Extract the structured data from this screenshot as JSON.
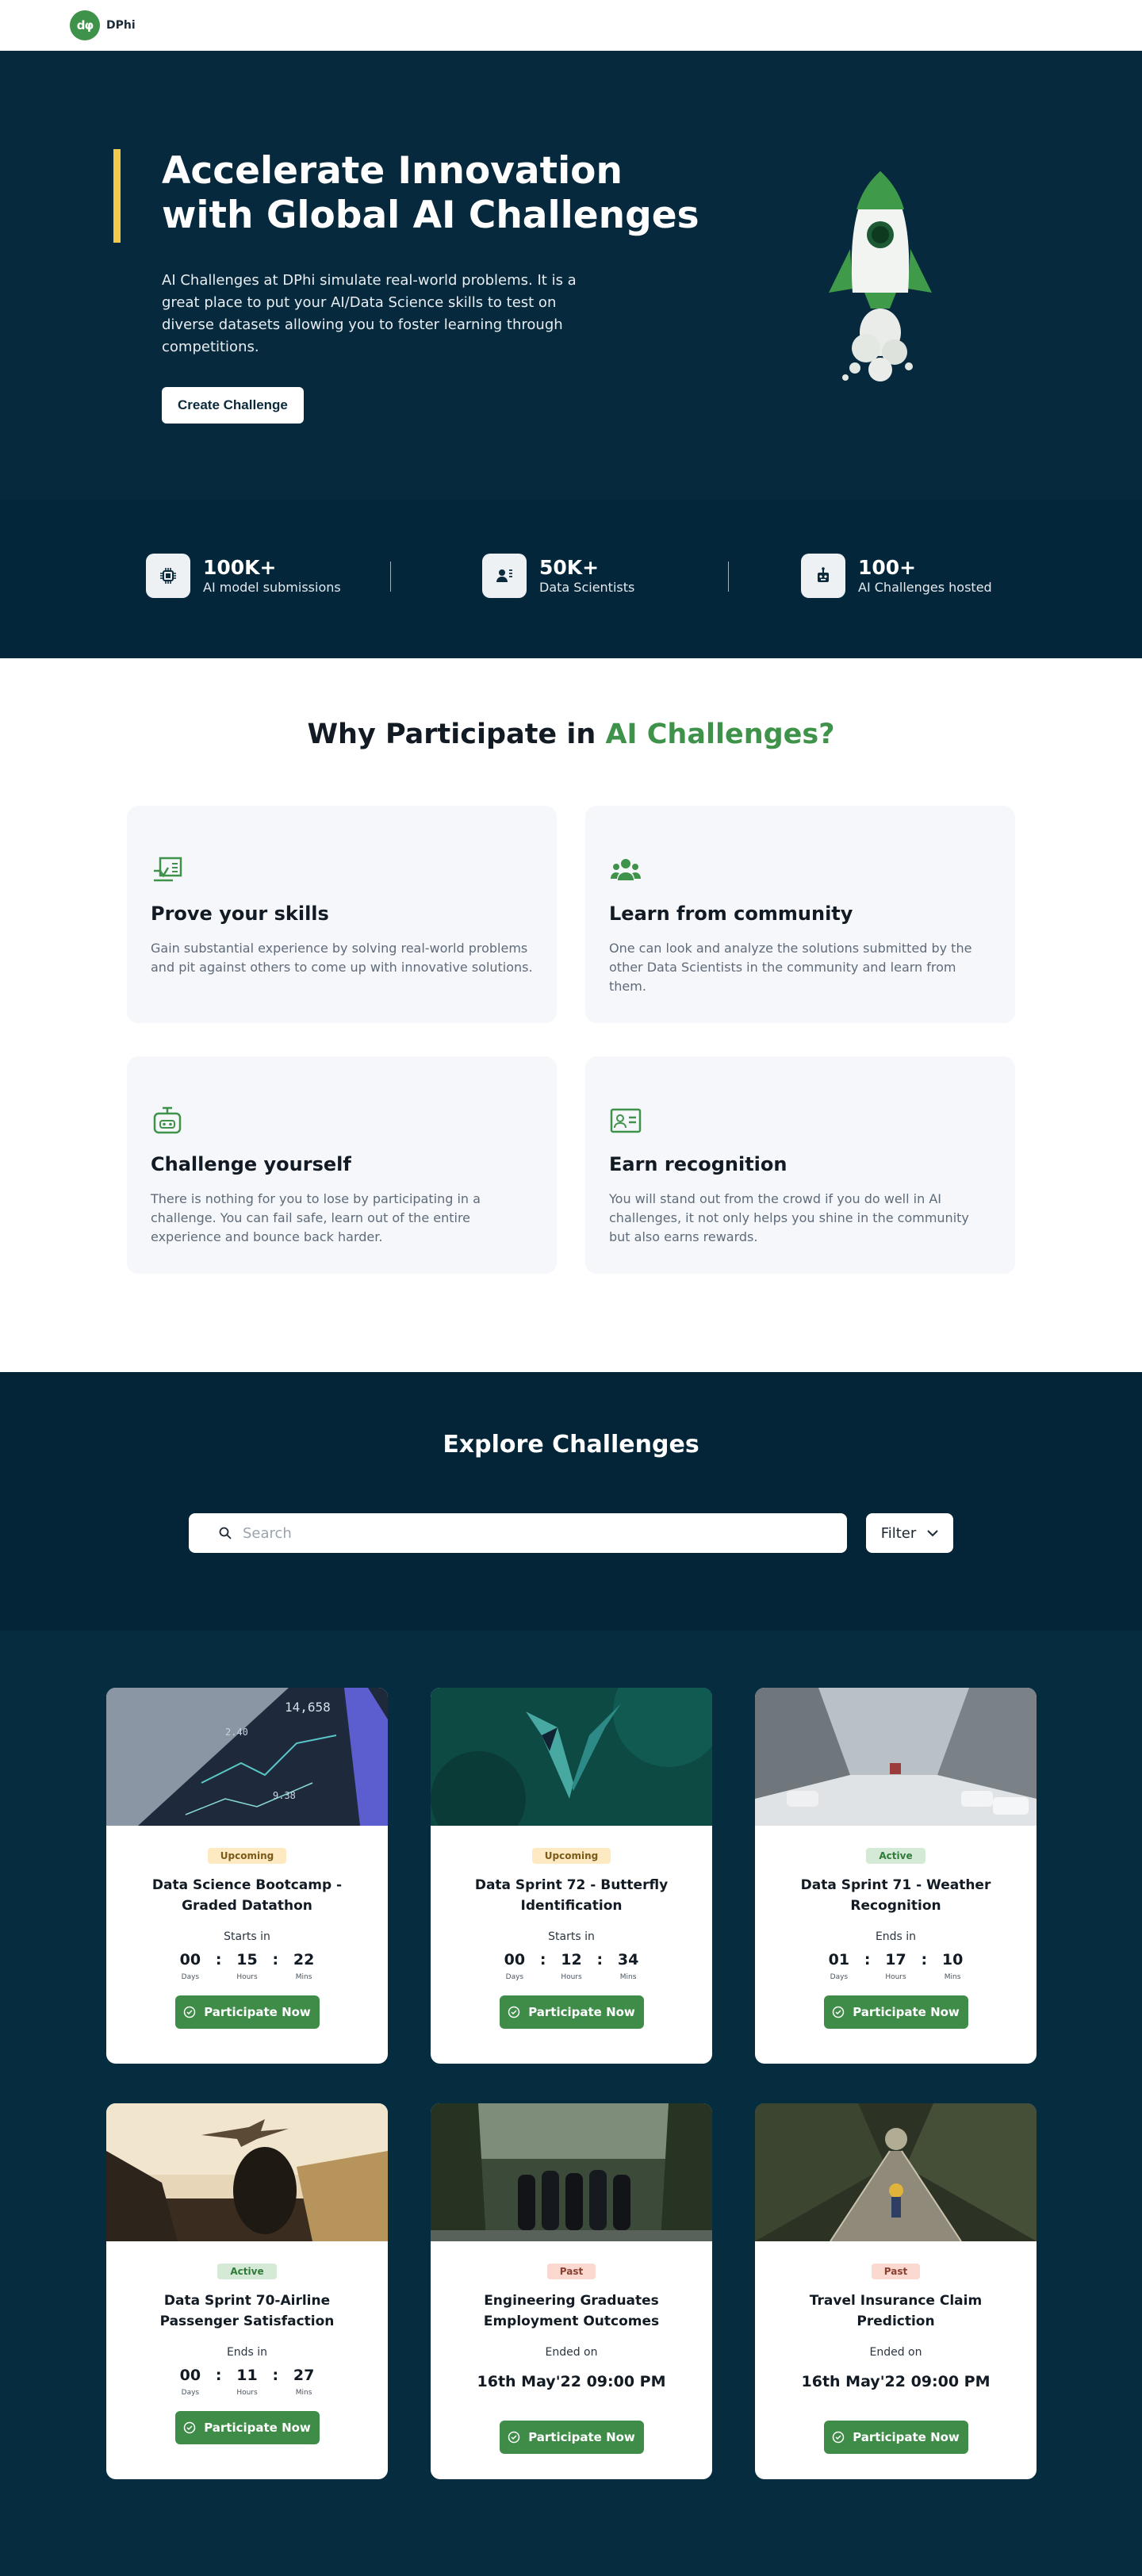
{
  "nav": {
    "logo_mark": "dφ",
    "logo_text": "DPhi"
  },
  "hero": {
    "title": "Accelerate Innovation with Global AI Challenges",
    "description": "AI Challenges at DPhi simulate real-world problems. It is a great place to put your AI/Data Science skills to test on diverse datasets allowing you to foster learning through competitions.",
    "cta_label": "Create Challenge",
    "illustration": "rocket-illustration"
  },
  "stats": [
    {
      "value": "100K+",
      "label": "AI model submissions",
      "icon": "chip-icon"
    },
    {
      "value": "50K+",
      "label": "Data Scientists",
      "icon": "people-icon"
    },
    {
      "value": "100+",
      "label": "AI Challenges hosted",
      "icon": "robot-icon"
    }
  ],
  "why": {
    "title_prefix": "Why Participate in ",
    "title_accent": "AI Challenges?",
    "accent_color": "#3f9249",
    "cards": [
      {
        "title": "Prove your skills",
        "desc": "Gain substantial experience by solving real-world problems and pit against others to come up with innovative solutions.",
        "icon": "screen-chart-icon"
      },
      {
        "title": "Learn from community",
        "desc": "One can look and analyze the solutions submitted by the other Data Scientists in the community and learn from them.",
        "icon": "community-icon"
      },
      {
        "title": "Challenge yourself",
        "desc": "There is nothing for you to lose by participating in a challenge. You can fail safe, learn out of the entire experience and bounce back harder.",
        "icon": "robot-icon"
      },
      {
        "title": "Earn recognition",
        "desc": "You will stand out from the crowd if you do well in AI challenges, it not only helps you shine in the community but also earns rewards.",
        "icon": "id-card-icon"
      }
    ]
  },
  "explore": {
    "title": "Explore Challenges",
    "search_placeholder": "Search",
    "filter_label": "Filter"
  },
  "countdown_labels": {
    "days": "Days",
    "hours": "Hours",
    "mins": "Mins"
  },
  "participate_label": "Participate Now",
  "challenges": [
    {
      "status": "Upcoming",
      "title": "Data Science Bootcamp - Graded Datathon",
      "meta": "Starts in",
      "days": "00",
      "hours": "15",
      "mins": "22",
      "image": "stock-screen-image"
    },
    {
      "status": "Upcoming",
      "title": "Data Sprint 72 - Butterfly Identification",
      "meta": "Starts in",
      "days": "00",
      "hours": "12",
      "mins": "34",
      "image": "butterfly-image"
    },
    {
      "status": "Active",
      "title": "Data Sprint 71 - Weather Recognition",
      "meta": "Ends in",
      "days": "01",
      "hours": "17",
      "mins": "10",
      "image": "snowy-street-image"
    },
    {
      "status": "Active",
      "title": "Data Sprint 70-Airline Passenger Satisfaction",
      "meta": "Ends in",
      "days": "00",
      "hours": "11",
      "mins": "27",
      "image": "airport-image"
    },
    {
      "status": "Past",
      "title": "Engineering Graduates Employment Outcomes",
      "meta": "Ended on",
      "date": "16th May'22 09:00 PM",
      "image": "graduates-image"
    },
    {
      "status": "Past",
      "title": "Travel Insurance Claim Prediction",
      "meta": "Ended on",
      "date": "16th May'22 09:00 PM",
      "image": "bridge-image"
    }
  ]
}
